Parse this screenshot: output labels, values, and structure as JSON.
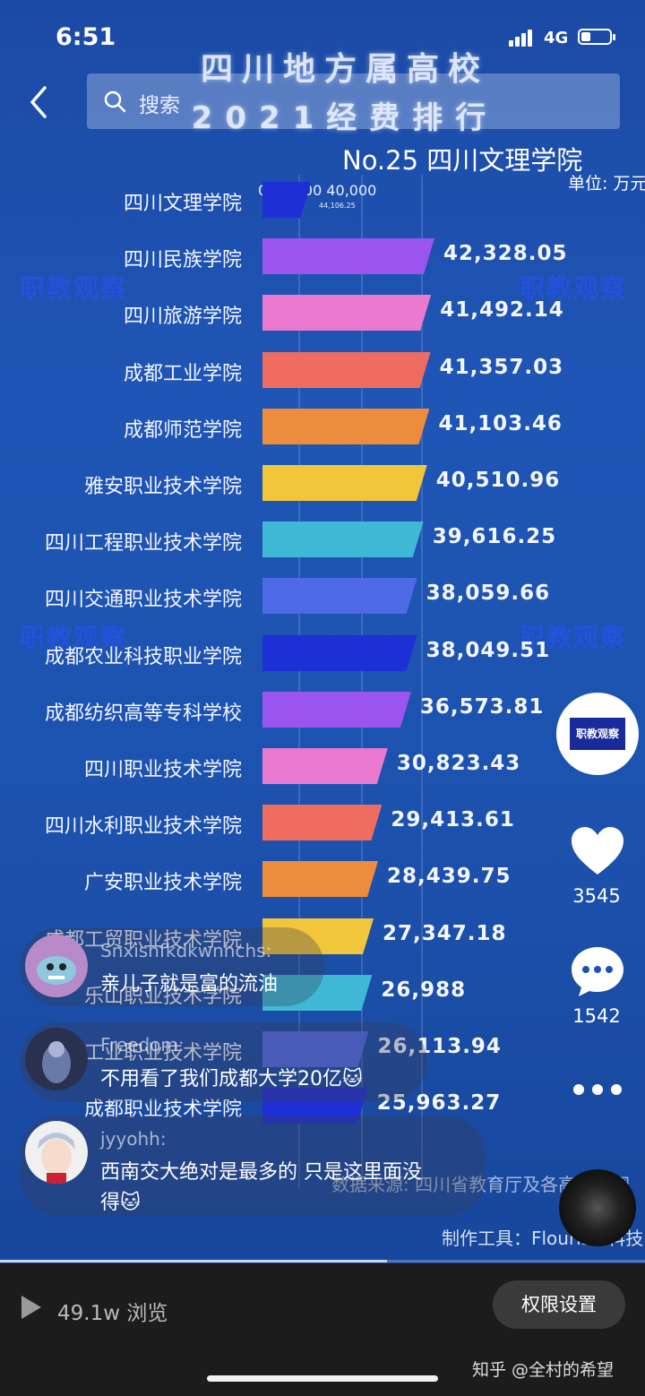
{
  "status_bar": {
    "time": "6:51",
    "network": "4G"
  },
  "video": {
    "title_line1": "四川地方属高校",
    "title_line2": "2021经费排行",
    "search_placeholder": "搜索",
    "rank_title": "No.25 四川文理学院",
    "unit": "单位: 万元",
    "axis_ticks": "0 20,000 40,000",
    "axis_sub": "44,106.25",
    "source": "数据来源: 四川省教育厅及各高校官网",
    "tool": "制作工具：Flourish 科技",
    "watermark_text": "职教观察"
  },
  "chart_data": {
    "type": "bar",
    "orientation": "horizontal",
    "categories": [
      "四川文理学院",
      "四川民族学院",
      "四川旅游学院",
      "成都工业学院",
      "成都师范学院",
      "雅安职业技术学院",
      "四川工程职业技术学院",
      "四川交通职业技术学院",
      "成都农业科技职业学院",
      "成都纺织高等专科学校",
      "四川职业技术学院",
      "四川水利职业技术学院",
      "广安职业技术学院",
      "成都工贸职业技术学院",
      "乐山职业技术学院",
      "工业职业技术学院",
      "成都职业技术学院"
    ],
    "value_labels": [
      "",
      "42,328.05",
      "41,492.14",
      "41,357.03",
      "41,103.46",
      "40,510.96",
      "39,616.25",
      "38,059.66",
      "38,049.51",
      "36,573.81",
      "30,823.43",
      "29,413.61",
      "28,439.75",
      "27,347.18",
      "26,988",
      "26,113.94",
      "25,963.27"
    ],
    "values": [
      12000,
      42328.05,
      41492.14,
      41357.03,
      41103.46,
      40510.96,
      39616.25,
      38059.66,
      38049.51,
      36573.81,
      30823.43,
      29413.61,
      28439.75,
      27347.18,
      26988,
      26113.94,
      25963.27
    ],
    "colors": [
      "#1e2fd6",
      "#9b55ef",
      "#e97ad0",
      "#ef6d60",
      "#ee8c3e",
      "#f2c63a",
      "#3fb8d6",
      "#4f6ae6",
      "#1e2fd6",
      "#9b55ef",
      "#e97ad0",
      "#ef6d60",
      "#ee8c3e",
      "#f2c63a",
      "#3fb8d6",
      "#4f6ae6",
      "#1e2fd6"
    ],
    "xlim": [
      0,
      44000
    ]
  },
  "actions": {
    "likes": "3545",
    "comments": "1542",
    "author_logo_text": "职教观察"
  },
  "comments": [
    {
      "user": "Snxisnfkdkwnhchs:",
      "text": "亲儿子就是富的流油"
    },
    {
      "user": "Freedom:",
      "text": "不用看了我们成都大学20亿🐱"
    },
    {
      "user": "jyyohh:",
      "text": "西南交大绝对是最多的 只是这里面没",
      "text2": "得🐱"
    }
  ],
  "progress": 0.6,
  "bottom_bar": {
    "views": "49.1w 浏览",
    "permission_button": "权限设置",
    "credit": "知乎 @全村的希望"
  }
}
